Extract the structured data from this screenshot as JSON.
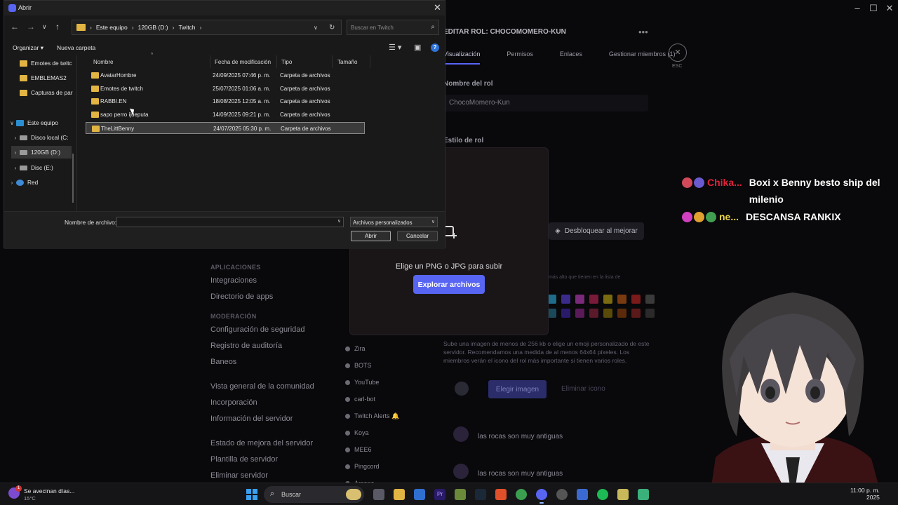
{
  "dialog": {
    "title": "Abrir",
    "breadcrumb": [
      "Este equipo",
      "120GB (D:)",
      "Twitch"
    ],
    "search_placeholder": "Buscar en Twitch",
    "toolbar": {
      "organize": "Organizar",
      "new_folder": "Nueva carpeta"
    },
    "tree": [
      {
        "label": "Emotes de twitc",
        "type": "folder"
      },
      {
        "label": "EMBLEMAS2",
        "type": "folder"
      },
      {
        "label": "Capturas de par",
        "type": "folder"
      },
      {
        "label": "Este equipo",
        "type": "pc",
        "expanded": true
      },
      {
        "label": "Disco local (C:",
        "type": "drive"
      },
      {
        "label": "120GB (D:)",
        "type": "drive",
        "selected": true
      },
      {
        "label": "Disc (E:)",
        "type": "drive"
      },
      {
        "label": "Red",
        "type": "network"
      }
    ],
    "columns": [
      "Nombre",
      "Fecha de modificación",
      "Tipo",
      "Tamaño"
    ],
    "files": [
      {
        "name": "AvatarHombre",
        "date": "24/09/2025 07:46 p. m.",
        "type": "Carpeta de archivos"
      },
      {
        "name": "Emotes de twitch",
        "date": "25/07/2025 01:06 a. m.",
        "type": "Carpeta de archivos"
      },
      {
        "name": "RABBI.EN",
        "date": "18/08/2025 12:05 a. m.",
        "type": "Carpeta de archivos"
      },
      {
        "name": "sapo perro ijueputa",
        "date": "14/09/2025 09:21 p. m.",
        "type": "Carpeta de archivos"
      },
      {
        "name": "TheLittBenny",
        "date": "24/07/2025 05:30 p. m.",
        "type": "Carpeta de archivos",
        "selected": true
      }
    ],
    "filename_label": "Nombre de archivo:",
    "filename_value": "",
    "filter": "Archivos personalizados",
    "open_button": "Abrir",
    "cancel_button": "Cancelar"
  },
  "discord": {
    "edit_title": "EDITAR ROL: CHOCOMOMERO-KUN",
    "tabs": [
      "Visualización",
      "Permisos",
      "Enlaces",
      "Gestionar miembros (1)"
    ],
    "esc_label": "ESC",
    "role_name_label": "Nombre del rol",
    "role_name_value": "ChocoMomero-Kun",
    "role_style_label": "Estilo de rol",
    "unlock_button": "Desbloquear al mejorar",
    "color_note": "más alto que tienen en la lista de",
    "icon_description": "Sube una imagen de menos de 256 kb o elige un emoji personalizado de este servidor. Recomendamos una medida de al menos 64x64 píxeles. Los miembros verán el icono del rol más importante si tienen varios roles.",
    "choose_image_button": "Elegir imagen",
    "remove_icon_button": "Eliminar icono",
    "preview_messages": [
      "las rocas son muy antiguas",
      "las rocas son muy antiguas"
    ],
    "upload_text": "Elige un PNG o JPG para subir",
    "upload_button": "Explorar archivos",
    "sidebar": {
      "apps_section": "APLICACIONES",
      "apps_links": [
        "Integraciones",
        "Directorio de apps"
      ],
      "mod_section": "MODERACIÓN",
      "mod_links": [
        "Configuración de seguridad",
        "Registro de auditoría",
        "Baneos",
        "Vista general de la comunidad",
        "Incorporación",
        "Información del servidor",
        "Estado de mejora del servidor",
        "Plantilla de servidor",
        "Eliminar servidor"
      ]
    },
    "roles_list": [
      "Zira",
      "BOTS",
      "YouTube",
      "carl-bot",
      "Twitch Alerts 🔔",
      "Koya",
      "MEE6",
      "Pingcord",
      "Arcane"
    ],
    "swatch_colors": [
      "#1f6b8a",
      "#3a2a8a",
      "#7a2a7a",
      "#7a1a3a",
      "#7a6a10",
      "#7a3a10",
      "#7a1a1a",
      "#3a3a3a",
      "#1a4a5a",
      "#2a1a6a",
      "#5a1a5a",
      "#5a1a2a",
      "#5a4a0a",
      "#5a2a0a",
      "#5a1a1a",
      "#2a2a2a"
    ]
  },
  "chat": [
    {
      "name": "Chika...",
      "name_color": "#e0243a",
      "message": "Boxi x Benny besto ship del milenio",
      "badges": [
        "#d24a5a",
        "#6a5ad0"
      ]
    },
    {
      "name": "ne...",
      "name_color": "#e8d44a",
      "message": "DESCANSA RANKIX",
      "badges": [
        "#d040c0",
        "#e0a030",
        "#40a050"
      ]
    }
  ],
  "taskbar": {
    "weather_title": "Se avecinan días...",
    "weather_temp": "15°C",
    "weather_badge": "1",
    "search": "Buscar",
    "clock_time": "11:00 p. m.",
    "clock_date": "2025"
  },
  "colors": {
    "accent": "#5865f2",
    "folder": "#e2b443"
  }
}
